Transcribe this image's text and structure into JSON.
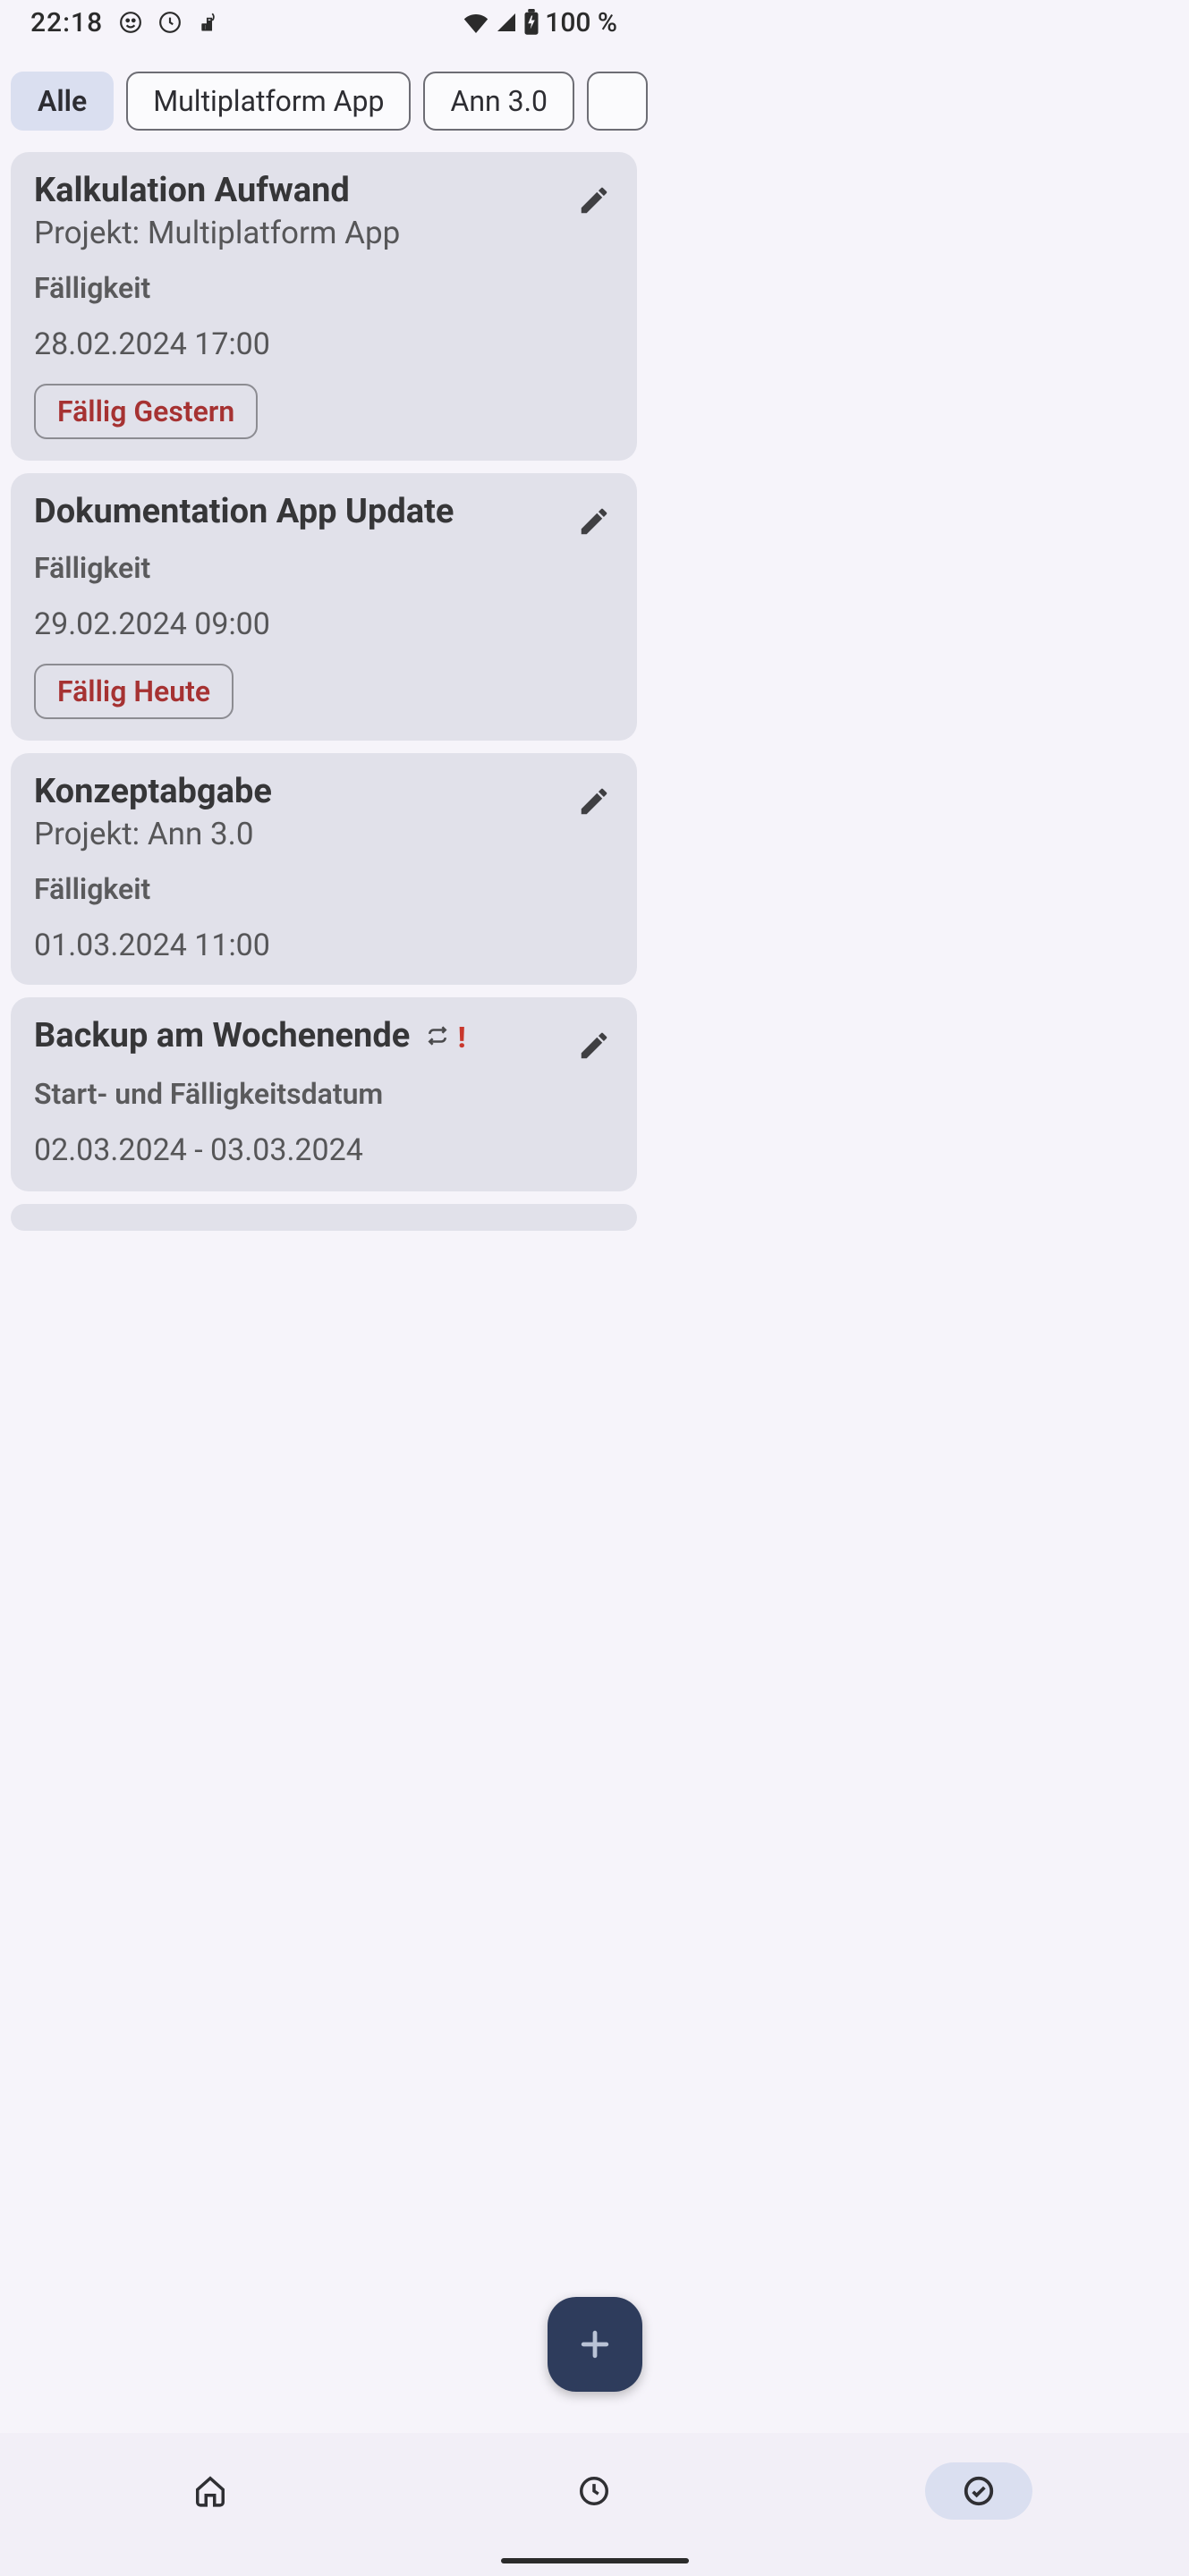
{
  "status": {
    "time": "22:18",
    "battery_text": "100 %"
  },
  "filters": {
    "chips": [
      {
        "label": "Alle",
        "active": true
      },
      {
        "label": "Multiplatform App",
        "active": false
      },
      {
        "label": "Ann 3.0",
        "active": false
      }
    ]
  },
  "tasks": [
    {
      "title": "Kalkulation Aufwand",
      "project": "Projekt: Multiplatform App",
      "due_label": "Fälligkeit",
      "due_date": "28.02.2024 17:00",
      "badge": "Fällig Gestern"
    },
    {
      "title": "Dokumentation App Update",
      "project": "",
      "due_label": "Fälligkeit",
      "due_date": "29.02.2024 09:00",
      "badge": "Fällig Heute"
    },
    {
      "title": "Konzeptabgabe",
      "project": "Projekt: Ann 3.0",
      "due_label": "Fälligkeit",
      "due_date": "01.03.2024 11:00",
      "badge": ""
    },
    {
      "title": "Backup am Wochenende",
      "project": "",
      "due_label": "Start- und Fälligkeitsdatum",
      "due_date": "02.03.2024 - 03.03.2024",
      "badge": "",
      "has_repeat_icon": true,
      "has_priority_icon": true
    }
  ],
  "icons": {
    "face": "face-icon",
    "clock": "clock-icon",
    "data": "data-icon",
    "wifi": "wifi-icon",
    "signal": "signal-icon",
    "battery": "battery-icon",
    "pencil": "pencil-icon",
    "repeat": "repeat-icon",
    "priority": "priority-icon",
    "plus": "plus-icon",
    "home": "home-icon",
    "nav_clock": "clock-icon",
    "check": "check-circle-icon"
  }
}
